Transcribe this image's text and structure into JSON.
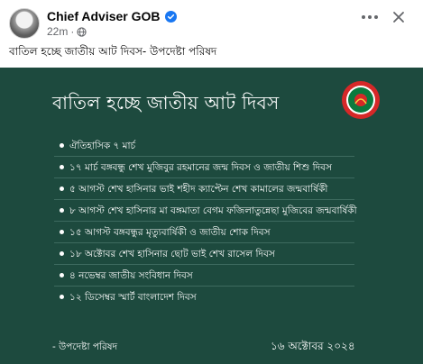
{
  "post": {
    "author": "Chief Adviser GOB",
    "time": "22m",
    "separator": "·",
    "text": "বাতিল হচ্ছে জাতীয় আট দিবস- উপদেষ্টা পরিষদ"
  },
  "card": {
    "title": "বাতিল হচ্ছে জাতীয় আট দিবস",
    "items": [
      "ঐতিহাসিক ৭ মার্চ",
      "১৭ মার্চ বঙ্গবন্ধু শেখ মুজিবুর রহমানের জন্ম দিবস ও জাতীয় শিশু দিবস",
      "৫ আগস্ট শেখ হাসিনার ভাই শহীদ ক্যাপ্টেন শেখ কামালের জন্মবার্ষিকী",
      "৮ আগস্ট শেখ হাসিনার মা বঙ্গমাতা বেগম ফজিলাতুন্নেছা মুজিবের জন্মবার্ষিকী",
      "১৫ আগস্ট বঙ্গবন্ধুর মৃত্যুবার্ষিকী ও জাতীয় শোক দিবস",
      "১৮ অক্টোবর শেখ হাসিনার ছোট ভাই শেখ রাসেল দিবস",
      "৪ নভেম্বর জাতীয় সংবিধান দিবস",
      "১২ ডিসেম্বর স্মার্ট বাংলাদেশ দিবস"
    ],
    "signature": "- উপদেষ্টা পরিষদ",
    "date": "১৬ অক্টোবর ২০২৪"
  },
  "colors": {
    "card_background": "#1d4a3e",
    "verified_badge": "#1877f2",
    "emblem_red": "#d62828",
    "emblem_green": "#0b7a3e"
  },
  "icons": {
    "verified": "verified-badge-icon",
    "audience": "globe-icon",
    "more": "more-options-icon",
    "close": "close-icon",
    "emblem": "government-emblem-icon"
  }
}
